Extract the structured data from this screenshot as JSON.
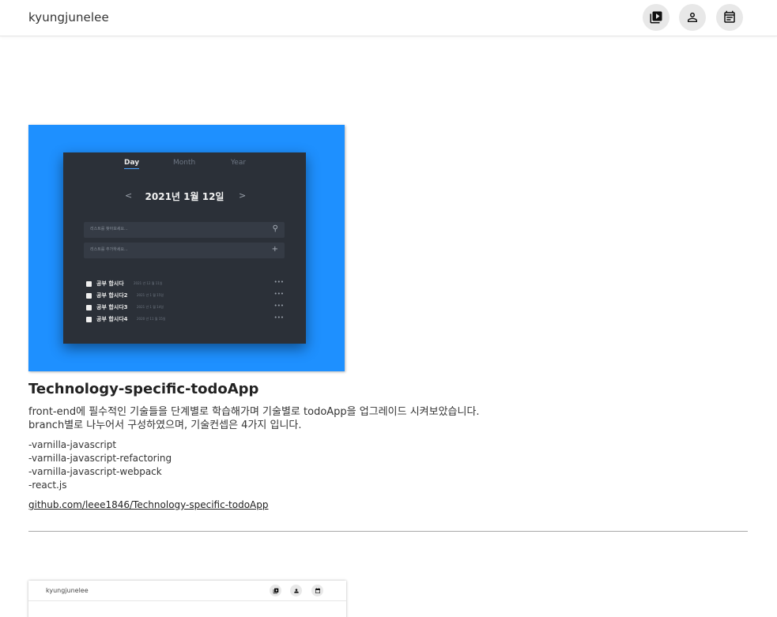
{
  "header": {
    "brand": "kyungjunelee",
    "icons": [
      "playlist-play-icon",
      "person-icon",
      "calendar-icon"
    ]
  },
  "project": {
    "screenshot": {
      "tabs": [
        "Day",
        "Month",
        "Year"
      ],
      "active_tab": "Day",
      "date": "2021년 1월 12일",
      "prev": "<",
      "next": ">",
      "search_placeholder": "리스트를 찾아보세요...",
      "add_placeholder": "리스트를 추가하세요...",
      "items": [
        {
          "title": "공부 합시다",
          "date": "2021 년 12 월 11일"
        },
        {
          "title": "공부 합시다2",
          "date": "2021 년 1 월 15일"
        },
        {
          "title": "공부 합시다3",
          "date": "2021 년 1 월 14일"
        },
        {
          "title": "공부 합시다4",
          "date": "2020 년 11 월 15일"
        }
      ],
      "more": "•••",
      "background_color": "#1e90ff"
    },
    "title": "Technology-specific-todoApp",
    "description_line1": "front-end에 필수적인 기술들을 단계별로 학습해가며 기술별로 todoApp을 업그레이드 시켜보았습니다.",
    "description_line2": "branch별로 나누어서 구성하였으며, 기술컨셉은 4가지 입니다.",
    "branches": [
      "-varnilla-javascript",
      "-varnilla-javascript-refactoring",
      "-varnilla-javascript-webpack",
      "-react.js"
    ],
    "link": "github.com/leee1846/Technology-specific-todoApp"
  },
  "next_project": {
    "brand": "kyungjunelee"
  }
}
